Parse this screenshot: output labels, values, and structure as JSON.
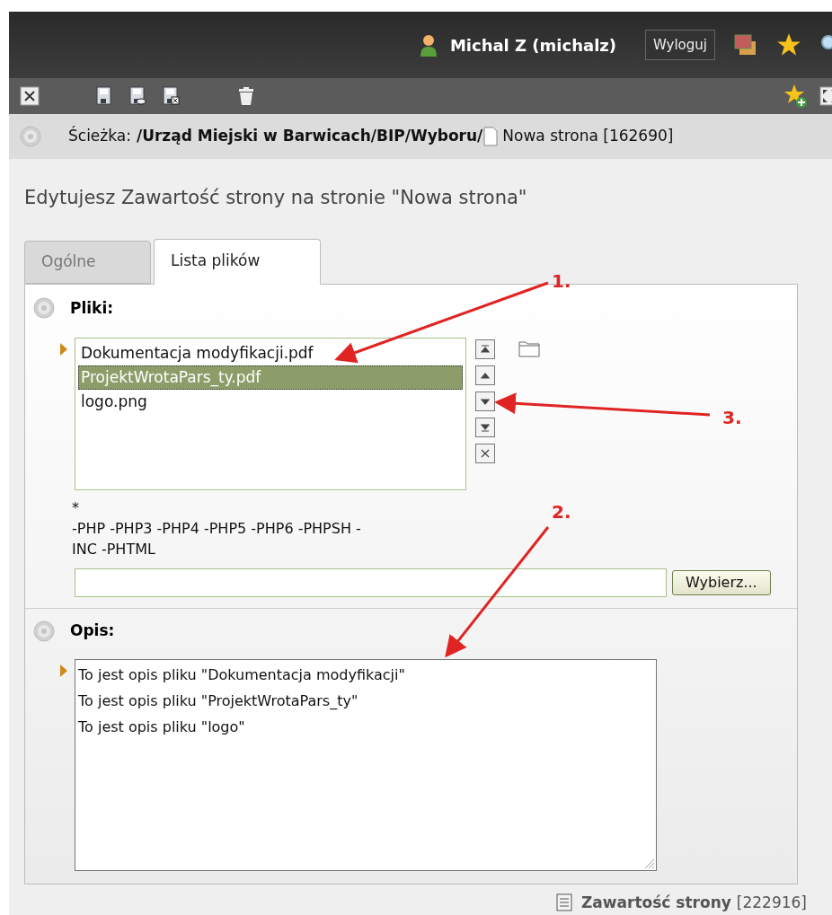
{
  "user": {
    "name": "Michal Z (michalz)"
  },
  "logout": "Wyloguj",
  "path": {
    "label": "Ścieżka:",
    "value": "/Urząd Miejski w Barwicach/BIP/Wyboru/",
    "page": "Nowa strona [162690]"
  },
  "heading": "Edytujesz Zawartość strony na stronie \"Nowa strona\"",
  "tabs": [
    {
      "label": "Ogólne",
      "selected": false
    },
    {
      "label": "Lista plików",
      "selected": true
    }
  ],
  "files": {
    "label": "Pliki:",
    "items": [
      {
        "name": "Dokumentacja modyfikacji.pdf",
        "selected": false
      },
      {
        "name": "ProjektWrotaPars_ty.pdf",
        "selected": true
      },
      {
        "name": "logo.png",
        "selected": false
      }
    ],
    "note_lines": [
      "*",
      "-PHP -PHP3 -PHP4 -PHP5 -PHP6 -PHPSH -",
      "INC -PHTML"
    ],
    "browse_button": "Wybierz..."
  },
  "description": {
    "label": "Opis:",
    "lines": [
      "To jest opis pliku \"Dokumentacja modyfikacji\"",
      "To jest opis pliku \"ProjektWrotaPars_ty\"",
      "To jest opis pliku \"logo\""
    ]
  },
  "footer": {
    "title": "Zawartość strony",
    "id": "[222916]"
  },
  "annotations": [
    {
      "label": "1."
    },
    {
      "label": "2."
    },
    {
      "label": "3."
    }
  ]
}
